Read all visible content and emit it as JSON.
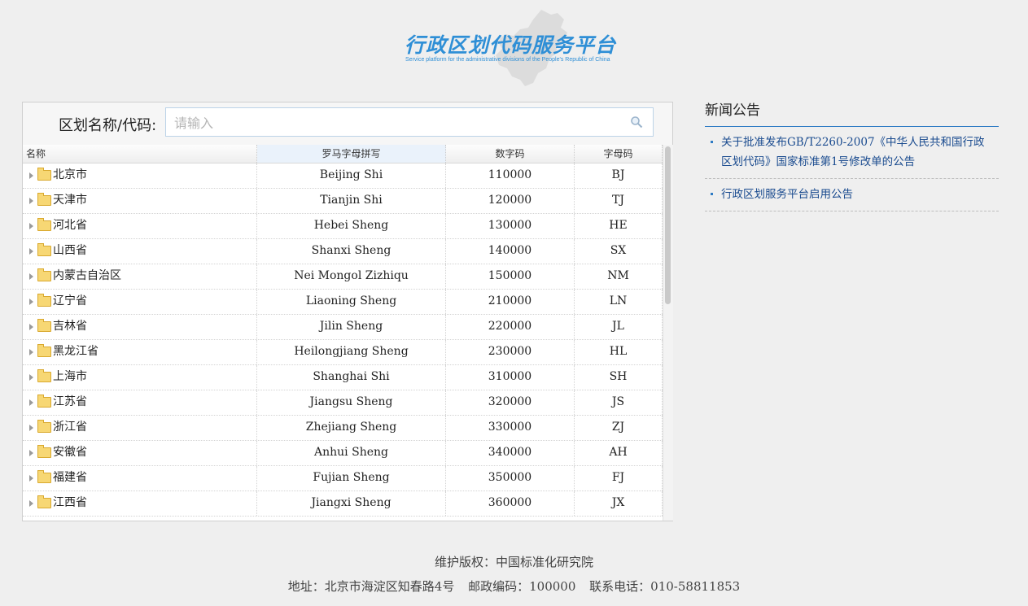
{
  "header": {
    "title": "行政区划代码服务平台",
    "subtitle": "Service platform for the administrative divisions of the People's Republic of China"
  },
  "search": {
    "label": "区划名称/代码:",
    "placeholder": "请输入"
  },
  "table": {
    "columns": [
      "名称",
      "罗马字母拼写",
      "数字码",
      "字母码"
    ],
    "rows": [
      {
        "name": "北京市",
        "roman": "Beijing Shi",
        "code": "110000",
        "letter": "BJ"
      },
      {
        "name": "天津市",
        "roman": "Tianjin Shi",
        "code": "120000",
        "letter": "TJ"
      },
      {
        "name": "河北省",
        "roman": "Hebei Sheng",
        "code": "130000",
        "letter": "HE"
      },
      {
        "name": "山西省",
        "roman": "Shanxi Sheng",
        "code": "140000",
        "letter": "SX"
      },
      {
        "name": "内蒙古自治区",
        "roman": "Nei Mongol Zizhiqu",
        "code": "150000",
        "letter": "NM"
      },
      {
        "name": "辽宁省",
        "roman": "Liaoning Sheng",
        "code": "210000",
        "letter": "LN"
      },
      {
        "name": "吉林省",
        "roman": "Jilin Sheng",
        "code": "220000",
        "letter": "JL"
      },
      {
        "name": "黑龙江省",
        "roman": "Heilongjiang Sheng",
        "code": "230000",
        "letter": "HL"
      },
      {
        "name": "上海市",
        "roman": "Shanghai Shi",
        "code": "310000",
        "letter": "SH"
      },
      {
        "name": "江苏省",
        "roman": "Jiangsu Sheng",
        "code": "320000",
        "letter": "JS"
      },
      {
        "name": "浙江省",
        "roman": "Zhejiang Sheng",
        "code": "330000",
        "letter": "ZJ"
      },
      {
        "name": "安徽省",
        "roman": "Anhui Sheng",
        "code": "340000",
        "letter": "AH"
      },
      {
        "name": "福建省",
        "roman": "Fujian Sheng",
        "code": "350000",
        "letter": "FJ"
      },
      {
        "name": "江西省",
        "roman": "Jiangxi Sheng",
        "code": "360000",
        "letter": "JX"
      }
    ]
  },
  "news": {
    "title": "新闻公告",
    "items": [
      "关于批准发布GB/T2260-2007《中华人民共和国行政区划代码》国家标准第1号修改单的公告",
      "行政区划服务平台启用公告"
    ]
  },
  "footer": {
    "maintainer": "维护版权：中国标准化研究院",
    "address": "地址：北京市海淀区知春路4号",
    "postcode": "邮政编码：100000",
    "phone": "联系电话：010-58811853"
  },
  "colors": {
    "brand": "#2f8fd6",
    "link": "#1a4b8f",
    "accent_line": "#2e7bc4"
  }
}
